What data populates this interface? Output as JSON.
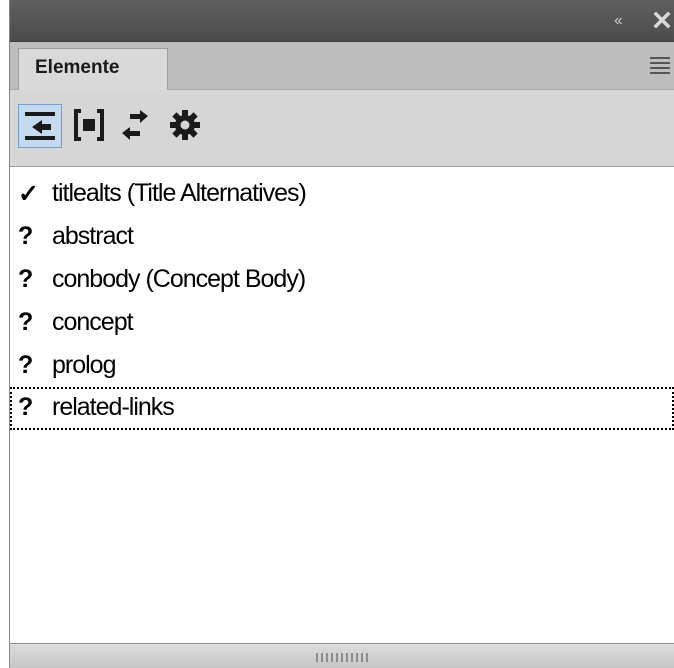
{
  "titlebar": {
    "collapse_glyph": "‹‹",
    "close_icon": "close-icon"
  },
  "tab": {
    "label": "Elemente"
  },
  "toolbar": {
    "buttons": [
      {
        "icon": "insert-element-icon",
        "active": true
      },
      {
        "icon": "wrap-element-icon",
        "active": false
      },
      {
        "icon": "change-element-icon",
        "active": false
      },
      {
        "icon": "settings-gear-icon",
        "active": false
      }
    ]
  },
  "elements": [
    {
      "mark": "✓",
      "label": "titlealts  (Title Alternatives)"
    },
    {
      "mark": "?",
      "label": "abstract"
    },
    {
      "mark": "?",
      "label": "conbody  (Concept Body)"
    },
    {
      "mark": "?",
      "label": "concept"
    },
    {
      "mark": "?",
      "label": "prolog"
    },
    {
      "mark": "?",
      "label": "related-links"
    }
  ],
  "colors": {
    "titlebar": "#555555",
    "tab_active": "#d9d9d9",
    "toolbar_active": "#c4daef",
    "list_bg": "#ffffff"
  }
}
